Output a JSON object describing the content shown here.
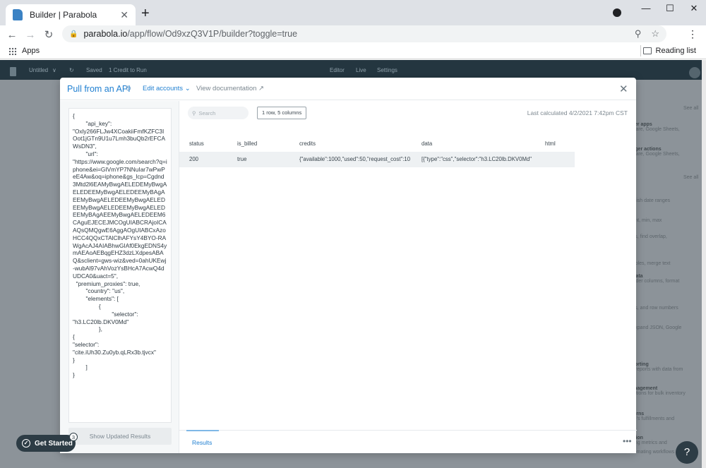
{
  "browser": {
    "tab_title": "Builder | Parabola",
    "new_tab": "+",
    "tab_close": "✕",
    "url_host": "parabola.io",
    "url_path": "/app/flow/Od9xzQ3V1P/builder?toggle=true",
    "bookmarks": {
      "apps": "Apps",
      "reading_list": "Reading list"
    }
  },
  "app_bar": {
    "doc_name": "Untitled",
    "saved": "Saved",
    "credit": "1 Credit to Run",
    "tab_editor": "Editor",
    "tab_live": "Live",
    "tab_settings": "Settings"
  },
  "side_panel": [
    {
      "title": "",
      "text": "See all"
    },
    {
      "title": "other apps",
      "text": "Square, Google Sheets,"
    },
    {
      "title": "trigger actions",
      "text": "Square, Google Sheets,"
    },
    {
      "title": "",
      "text": "See all"
    },
    {
      "title": "",
      "text": "publish date ranges"
    },
    {
      "title": "",
      "text": "count, min, max"
    },
    {
      "title": "ata",
      "text": "rows, find overlap,"
    },
    {
      "title": "",
      "text": "a tables, merge text"
    },
    {
      "title": "st data",
      "text": "reorder columns, format"
    },
    {
      "title": "",
      "text": "rows, and row numbers"
    },
    {
      "title": "",
      "text": "s, expand JSON, Google"
    },
    {
      "title": "reporting",
      "text": "ate reports with data from"
    },
    {
      "title": "management",
      "text": "solutions for bulk inventory"
    },
    {
      "title": "returns",
      "text": "erce's fulfillments and"
    },
    {
      "title": "mation",
      "text": "keting metrics and"
    },
    {
      "title": "",
      "text": "automating workflows"
    }
  ],
  "modal": {
    "title": "Pull from an API",
    "edit_accounts": "Edit accounts",
    "view_documentation": "View documentation",
    "request_body": "{\n        \"api_key\":\n\"Oxly266FLJw4XCoakiiFmfKZFC3IOot1jGTn9U1u7Lmh3buQb2rEFCAWsDN3\",\n        \"url\":\n\"https://www.google.com/search?q=iphone&ei=GIVmYP7NNuIar7wPwPeE4Aw&oq=iphone&gs_lcp=Cgdnd3Mtd2l6EAMyBwgAELEDEMyBwgAELEDEEMyBwgAELEDEEMyBAgAEEMyBwgAELEDEEMyBwgAELEDEEMyBwgAELEDEEMyBwgAELEDEEMyBAgAEEMyBwgAELEDEEM6CAguEJECEJMCOgUIABCRAjoICAAQsQMQgwE6AggAOgUIABCxAzoHCC4QQxCTAlClhAFYsY4BYO-RAWgAcAJ4AIABhwGIAf0EkgEDNS4ymAEAoAEBqgEHZ3dzLXdpesABAQ&sclient=gws-wiz&ved=0ahUKEwj-wubAl97vAhVozYsBHcA7AcwQ4dUDCA0&uact=5\",\n  \"premium_proxies\": true,\n        \"country\": \"us\",\n        \"elements\": [\n                {\n                        \"selector\":\n\"h3.LC20lb.DKV0Md\"\n                },\n{\n\"selector\":\n\"cite.iUh30.Zu0yb.qLRx3b.tjvcx\"\n}\n        ]\n}",
    "show_updated_results": "Show Updated Results",
    "search_placeholder": "Search",
    "row_count": "1 row, 5 columns",
    "last_calculated": "Last calculated 4/2/2021 7:42pm CST",
    "results_tab": "Results",
    "more": "•••"
  },
  "table": {
    "columns": [
      "status",
      "is_billed",
      "credits",
      "data",
      "html"
    ],
    "rows": [
      [
        "200",
        "true",
        "{\"available\":1000,\"used\":50,\"request_cost\":10",
        "[{\"type\":\"css\",\"selector\":\"h3.LC20lb.DKV0Md\"",
        ""
      ]
    ]
  },
  "floating": {
    "get_started": "Get Started",
    "badge_count": "3",
    "help": "?"
  }
}
